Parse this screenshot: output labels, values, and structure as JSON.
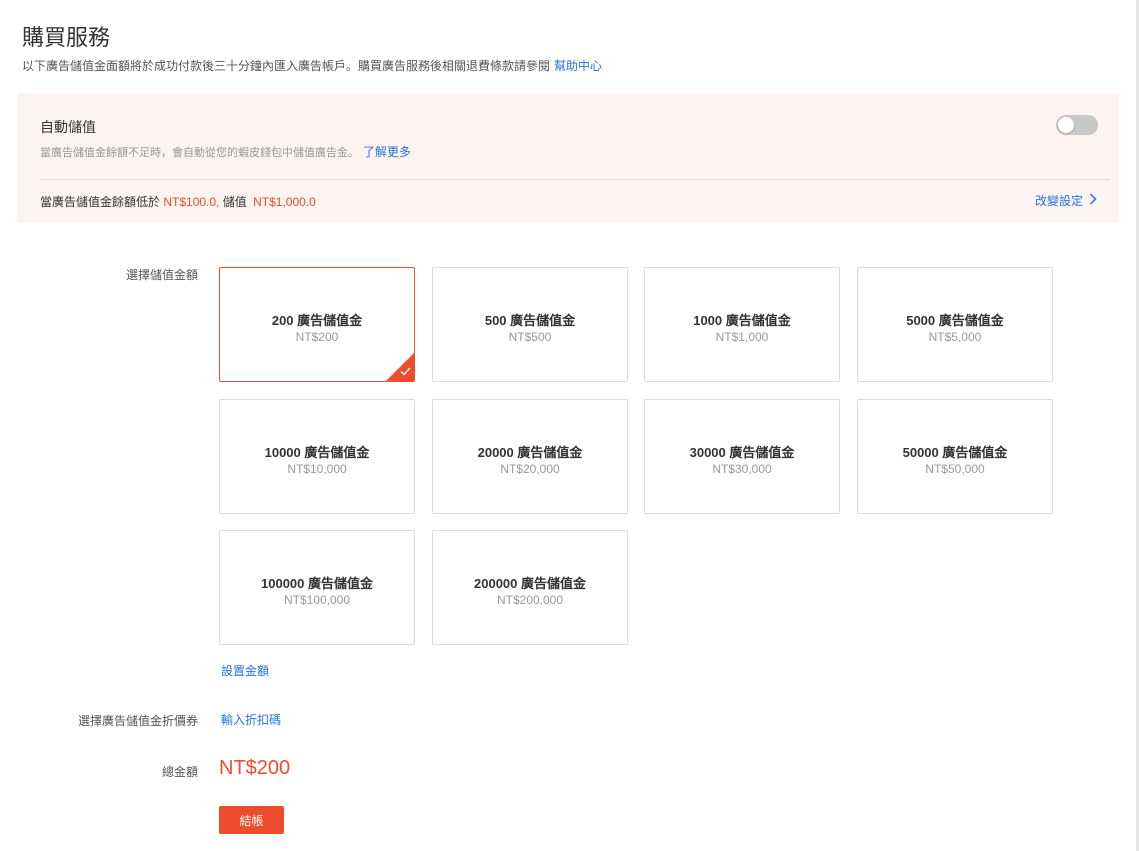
{
  "page": {
    "title": "購買服務",
    "subtitle": "以下廣告儲值金面額將於成功付款後三十分鐘內匯入廣告帳戶。購買廣告服務後相關退費條款請參閱",
    "help_link": "幫助中心"
  },
  "auto_topup": {
    "title": "自動儲值",
    "desc": "當廣告儲值金餘額不足時，會自動從您的蝦皮錢包中儲值廣告金。",
    "learn_more": "了解更多",
    "enabled": false,
    "rule_prefix": "當廣告儲值金餘額低於",
    "threshold": "NT$100.0,",
    "rule_mid": "儲值",
    "amount": "NT$1,000.0",
    "change_label": "改變設定",
    "change_icon": "chevron-right-icon"
  },
  "amount_section": {
    "label": "選擇儲值金額",
    "options": [
      {
        "name": "200 廣告儲值金",
        "price": "NT$200",
        "selected": true
      },
      {
        "name": "500 廣告儲值金",
        "price": "NT$500",
        "selected": false
      },
      {
        "name": "1000 廣告儲值金",
        "price": "NT$1,000",
        "selected": false
      },
      {
        "name": "5000 廣告儲值金",
        "price": "NT$5,000",
        "selected": false
      },
      {
        "name": "10000 廣告儲值金",
        "price": "NT$10,000",
        "selected": false
      },
      {
        "name": "20000 廣告儲值金",
        "price": "NT$20,000",
        "selected": false
      },
      {
        "name": "30000 廣告儲值金",
        "price": "NT$30,000",
        "selected": false
      },
      {
        "name": "50000 廣告儲值金",
        "price": "NT$50,000",
        "selected": false
      },
      {
        "name": "100000 廣告儲值金",
        "price": "NT$100,000",
        "selected": false
      },
      {
        "name": "200000 廣告儲值金",
        "price": "NT$200,000",
        "selected": false
      }
    ],
    "custom_link": "設置金額"
  },
  "coupon": {
    "label": "選擇廣告儲值金折價券",
    "link": "輸入折扣碼"
  },
  "total": {
    "label": "總金額",
    "value": "NT$200"
  },
  "checkout_label": "結帳",
  "colors": {
    "accent": "#ee4d2d",
    "link": "#2673dd",
    "banner_bg": "#fdf3f0"
  }
}
